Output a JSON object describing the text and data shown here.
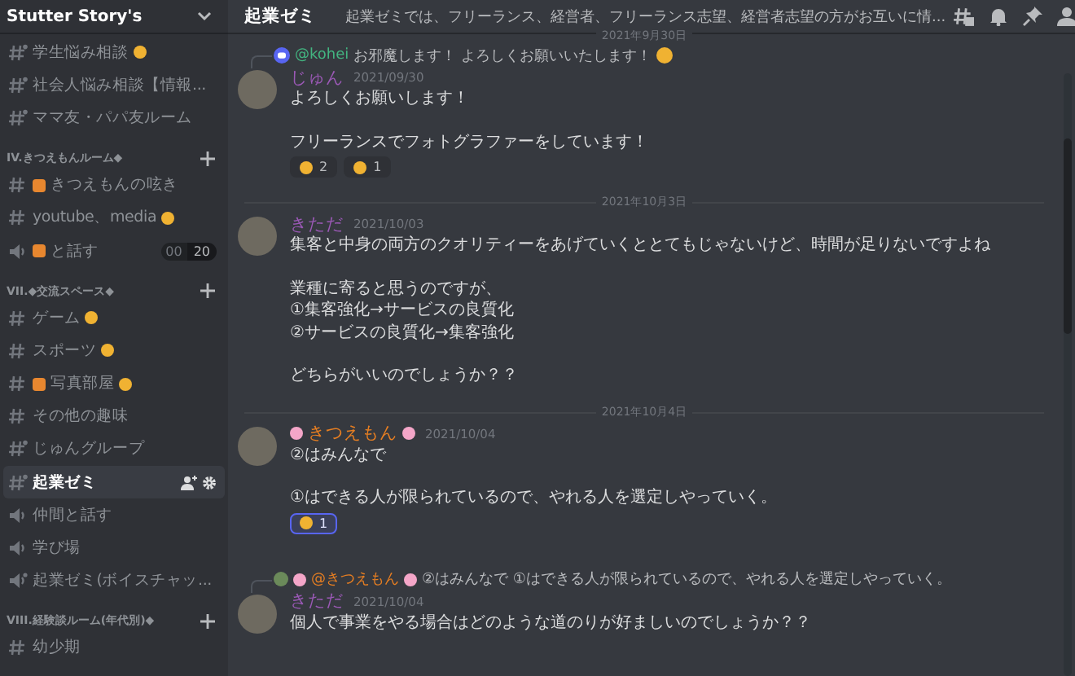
{
  "server": {
    "name": "Stutter Story's"
  },
  "sidebar": {
    "items": [
      {
        "kind": "private",
        "label": "学生悩み相談",
        "emoji": true,
        "selected": false
      },
      {
        "kind": "private",
        "label": "社会人悩み相談【情報...",
        "selected": false
      },
      {
        "kind": "private",
        "label": "ママ友・パパ友ルーム",
        "selected": false
      },
      {
        "kind": "category",
        "label": "IV.きつえもんルーム◆"
      },
      {
        "kind": "text",
        "label": "きつえもんの呟き",
        "emoji_before": true,
        "selected": false
      },
      {
        "kind": "text",
        "label": "youtube、media",
        "emoji": true,
        "selected": false
      },
      {
        "kind": "voice",
        "label": "と話す",
        "emoji_before": true,
        "selected": false,
        "user_count": "00",
        "user_limit": "20"
      },
      {
        "kind": "category",
        "label": "VII.◆交流スペース◆"
      },
      {
        "kind": "text",
        "label": "ゲーム",
        "emoji": true,
        "selected": false
      },
      {
        "kind": "text",
        "label": "スポーツ",
        "emoji": true,
        "selected": false
      },
      {
        "kind": "text",
        "label": "写真部屋",
        "emoji": true,
        "emoji_before": true,
        "selected": false
      },
      {
        "kind": "text",
        "label": "その他の趣味",
        "selected": false
      },
      {
        "kind": "private",
        "label": "じゅんグループ",
        "selected": false
      },
      {
        "kind": "private",
        "label": "起業ゼミ",
        "selected": true
      },
      {
        "kind": "voice",
        "label": "仲間と話す",
        "selected": false
      },
      {
        "kind": "voice",
        "label": "学び場",
        "selected": false
      },
      {
        "kind": "private-voice",
        "label": "起業ゼミ(ボイスチャッ...",
        "selected": false
      },
      {
        "kind": "category",
        "label": "VIII.経験談ルーム(年代別)◆"
      },
      {
        "kind": "text",
        "label": "幼少期",
        "selected": false
      }
    ]
  },
  "channel": {
    "name": "起業ゼミ",
    "topic": "起業ゼミでは、フリーランス、経営者、フリーランス志望、経営者志望の方がお互いに情..."
  },
  "messages": [
    {
      "kind": "divider",
      "label": "2021年9月30日"
    },
    {
      "kind": "message",
      "reply": {
        "mention": "@kohei",
        "color": "#43b581",
        "text": "お邪魔します！ よろしくお願いいたします！"
      },
      "author": "じゅん",
      "color": "#9b59b6",
      "time": "2021/09/30",
      "text": [
        [
          "よろしくお願いします！"
        ],
        [
          "フリーランスでフォトグラファーをしています！"
        ]
      ],
      "reactions": [
        {
          "count": "2",
          "selected": false
        },
        {
          "count": "1",
          "selected": false
        }
      ]
    },
    {
      "kind": "divider",
      "label": "2021年10月3日"
    },
    {
      "kind": "message",
      "author": "きただ",
      "color": "#9b59b6",
      "time": "2021/10/03",
      "text": [
        [
          "集客と中身の両方のクオリティーをあげていくととてもじゃないけど、時間が足りないですよね"
        ],
        [
          "業種に寄ると思うのですが、",
          "①集客強化→サービスの良質化",
          "②サービスの良質化→集客強化"
        ],
        [
          "どちらがいいのでしょうか？？"
        ]
      ]
    },
    {
      "kind": "divider",
      "label": "2021年10月4日"
    },
    {
      "kind": "message",
      "author": "きつえもん",
      "color": "#e67e22",
      "time": "2021/10/04",
      "text": [
        [
          "②はみんなで"
        ],
        [
          "①はできる人が限られているので、やれる人を選定しやっていく。"
        ]
      ],
      "reactions": [
        {
          "count": "1",
          "selected": true
        }
      ]
    },
    {
      "kind": "message",
      "reply": {
        "mention": "@きつえもん",
        "color": "#e67e22",
        "text": "②はみんなで ①はできる人が限られているので、やれる人を選定しやっていく。"
      },
      "author": "きただ",
      "color": "#9b59b6",
      "time": "2021/10/04",
      "text": [
        [
          "個人で事業をやる場合はどのような道のりが好ましいのでしょうか？？"
        ]
      ]
    }
  ]
}
